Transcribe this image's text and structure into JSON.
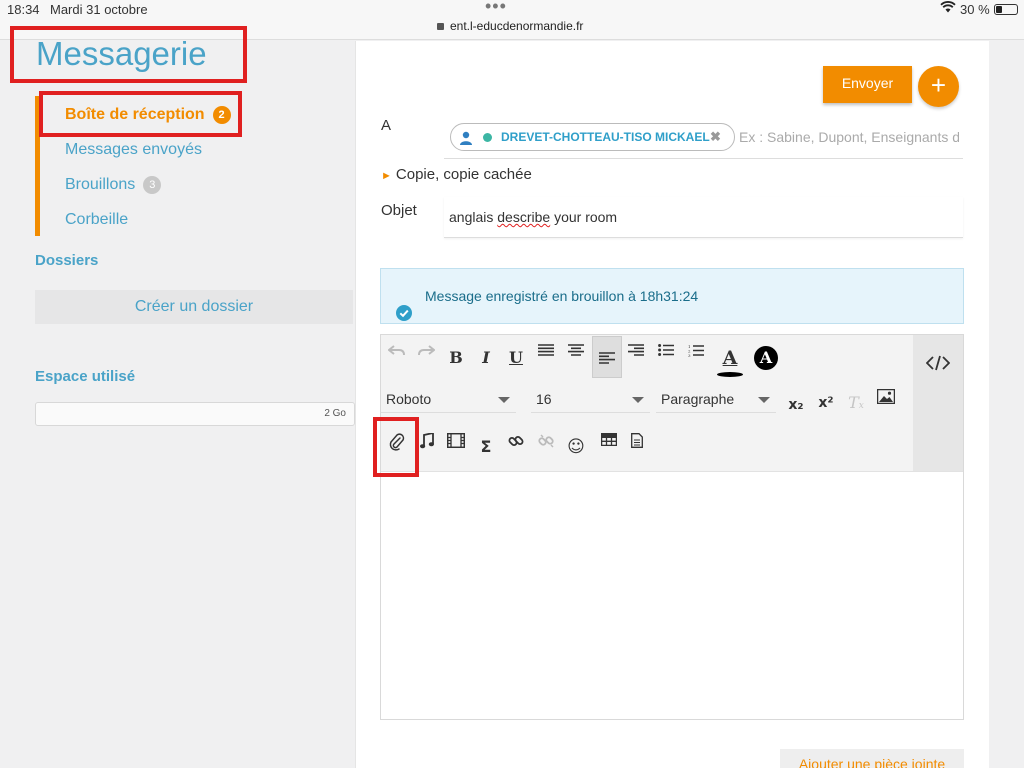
{
  "status_bar": {
    "time": "18:34",
    "date": "Mardi 31 octobre",
    "url": "ent.l-educdenormandie.fr",
    "battery_text": "30 %",
    "battery_level": 0.3,
    "wifi_icon": "wifi-icon"
  },
  "app": {
    "title": "Messagerie"
  },
  "sidebar": {
    "folders": [
      {
        "label": "Boîte de réception",
        "badge": "2",
        "active": true
      },
      {
        "label": "Messages envoyés"
      },
      {
        "label": "Brouillons",
        "badge": "3"
      },
      {
        "label": "Corbeille"
      }
    ],
    "dossiers_heading": "Dossiers",
    "create_folder": "Créer un dossier",
    "space_heading": "Espace utilisé",
    "space_total": "2 Go"
  },
  "compose": {
    "send_label": "Envoyer",
    "new_label": "+",
    "to_label": "A",
    "recipient": "DREVET-CHOTTEAU-TISO MICKAEL",
    "recipient_remove": "✖",
    "to_placeholder": "Ex : Sabine, Dupont, Enseignants de",
    "cc_label": "Copie, copie cachée",
    "cc_arrow": "►",
    "subject_label": "Objet",
    "subject_parts": [
      "anglais ",
      "describe",
      " your room"
    ],
    "saved_message": "Message enregistré en brouillon à 18h31:24",
    "attach_label": "Ajouter une pièce jointe"
  },
  "editor": {
    "font_family": "Roboto",
    "font_size": "16",
    "block_format": "Paragraphe",
    "buttons": {
      "bold": "B",
      "italic": "I",
      "underline": "U",
      "text_color": "A",
      "bg_color": "A",
      "subscript": "x₂",
      "superscript": "x²",
      "clear_format": "T",
      "sigma": "Σ",
      "emoji": "☺"
    }
  },
  "colors": {
    "accent": "#f28c00",
    "link": "#4aa3c8",
    "highlight": "#e02020",
    "info_bg": "#e6f4fb"
  }
}
